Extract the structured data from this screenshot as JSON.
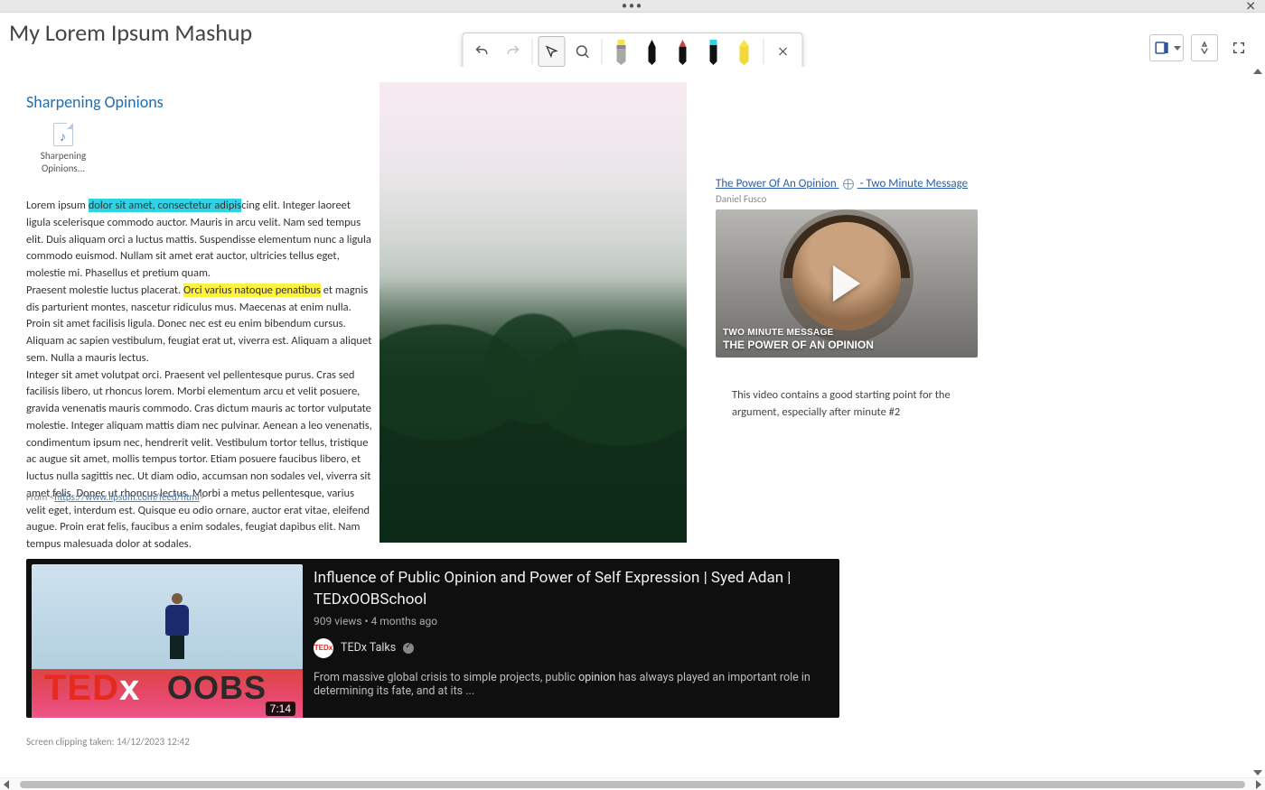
{
  "page_title": "My Lorem Ipsum Mashup",
  "section_title": "Sharpening Opinions",
  "audio_attachment": {
    "label": "Sharpening Opinions..."
  },
  "text": {
    "p1_a": "Lorem ipsum ",
    "p1_hl": "dolor sit amet, consectetur adipis",
    "p1_b": "cing elit. Integer laoreet ligula scelerisque commodo auctor. Mauris in arcu velit. Nam sed tempus elit. Duis aliquam orci a luctus mattis. Suspendisse elementum nunc a ligula commodo euismod. Nullam sit amet erat auctor, ultricies tellus eget, molestie mi. Phasellus et pretium quam.",
    "p2_a": "Praesent molestie luctus placerat. ",
    "p2_hl": "Orci varius natoque penatibus",
    "p2_b": " et magnis dis parturient montes, nascetur ridiculus mus. Maecenas at enim nulla. Proin sit amet facilisis ligula. Donec nec est eu enim bibendum cursus. Aliquam ac sapien vestibulum, feugiat erat ut, viverra est. Aliquam a aliquet sem. Nulla a mauris lectus.",
    "p3": "Integer sit amet volutpat orci. Praesent vel pellentesque purus. Cras sed facilisis libero, ut rhoncus lorem. Morbi elementum arcu et velit posuere, gravida venenatis mauris commodo. Cras dictum mauris ac tortor vulputate molestie. Integer aliquam mattis diam nec pulvinar. Aenean a leo venenatis, condimentum ipsum nec, hendrerit velit. Vestibulum tortor tellus, tristique ac augue sit amet, mollis tempus tortor. Etiam posuere faucibus libero, et luctus nulla sagittis nec. Ut diam odio, accumsan non sodales vel, viverra sit amet felis. Donec ut rhoncus lectus. Morbi a metus pellentesque, varius velit eget, interdum est. Quisque eu odio ornare, auctor erat vitae, eleifend augue. Proin erat felis, faucibus a enim sodales, feugiat dapibus elit. Nam tempus malesuada dolor at sodales."
  },
  "source": {
    "prefix": "From <",
    "url": "https://www.lipsum.com/feed/html",
    "suffix": ">"
  },
  "video": {
    "link_a": "The Power Of An Opinion ",
    "link_b": " - Two Minute Message",
    "author": "Daniel Fusco",
    "overlay_line1": "TWO MINUTE MESSAGE",
    "overlay_line2": "THE POWER OF AN OPINION",
    "note": "This video contains a good starting point for the argument, especially after minute #2"
  },
  "youtube": {
    "title": "Influence of Public Opinion and Power of Self Expression | Syed Adan | TEDxOOBSchool",
    "views": "909 views",
    "age": "4 months ago",
    "channel": "TEDx Talks",
    "avatar_text": "TEDx",
    "duration": "7:14",
    "tedx_red": "TED",
    "tedx_x": "x",
    "oobs": "OOBS",
    "desc_a": "From massive global crisis to simple projects, public ",
    "desc_bold": "opinion",
    "desc_b": " has always played an important role in determining its fate, and at its ..."
  },
  "clip_taken": "Screen clipping taken: 14/12/2023 12:42",
  "sysbar": {
    "dots": "•••",
    "close": "✕"
  }
}
